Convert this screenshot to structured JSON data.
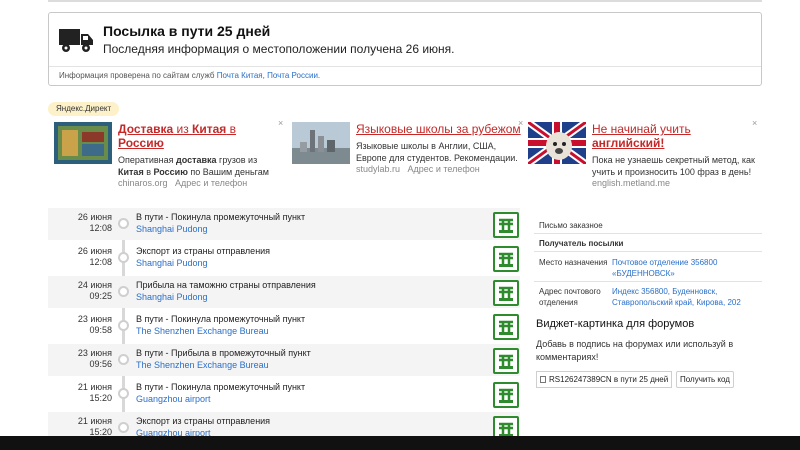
{
  "status": {
    "title": "Посылка в пути 25 дней",
    "subtitle": "Последняя информация о местоположении получена 26 июня.",
    "note_prefix": "Информация проверена по сайтам служб",
    "note_link1": "Почта Китая",
    "note_sep": ",",
    "note_link2": "Почта России",
    "note_end": "."
  },
  "ads": {
    "badge": "Яндекс.Директ",
    "items": [
      {
        "title_part1": "Доставка",
        "title_part2": " из ",
        "title_part3": "Китая",
        "title_part4": " в ",
        "title_part5": "Россию",
        "text_part1": "Оперативная ",
        "text_part2": "доставка",
        "text_part3": " грузов из ",
        "text_part4": "Китая",
        "text_part5": " в ",
        "text_part6": "Россию",
        "text_part7": " по Вашим деньгам",
        "domain": "chinaros.org",
        "contact": "Адрес и телефон"
      },
      {
        "title": "Языковые школы за рубежом",
        "text": "Языковые школы в Англии, США, Европе для студентов. Рекомендации.",
        "domain": "studylab.ru",
        "contact": "Адрес и телефон"
      },
      {
        "title_line1": "Не начинай учить",
        "title_line2": "английский!",
        "text": "Пока не узнаешь секретный метод, как учить и произносить 100 фраз в день!",
        "domain": "english.metland.me"
      }
    ]
  },
  "timeline": [
    {
      "date": "26 июня",
      "time": "12:08",
      "event": "В пути - Покинула промежуточный пункт",
      "place": "Shanghai Pudong"
    },
    {
      "date": "26 июня",
      "time": "12:08",
      "event": "Экспорт из страны отправления",
      "place": "Shanghai Pudong"
    },
    {
      "date": "24 июня",
      "time": "09:25",
      "event": "Прибыла на таможню страны отправления",
      "place": "Shanghai Pudong"
    },
    {
      "date": "23 июня",
      "time": "09:58",
      "event": "В пути - Покинула промежуточный пункт",
      "place": "The Shenzhen Exchange Bureau"
    },
    {
      "date": "23 июня",
      "time": "09:56",
      "event": "В пути - Прибыла в промежуточный пункт",
      "place": "The Shenzhen Exchange Bureau"
    },
    {
      "date": "21 июня",
      "time": "15:20",
      "event": "В пути - Покинула промежуточный пункт",
      "place": "Guangzhou airport"
    },
    {
      "date": "21 июня",
      "time": "15:20",
      "event": "Экспорт из страны отправления",
      "place": "Guangzhou airport"
    }
  ],
  "info": {
    "type": "Письмо заказное",
    "recipient_header": "Получатель посылки",
    "destination_label": "Место назначения",
    "destination_value": "Почтовое отделение 356800 «БУДЕННОВСК»",
    "address_label": "Адрес почтового отделения",
    "address_value": "Индекс 356800, Буденновск, Ставропольский край, Кирова, 202"
  },
  "widget": {
    "title": "Виджет-картинка для форумов",
    "text": "Добавь в подпись на форумах или используй в комментариях!",
    "code": "RS126247389CN в пути 25 дней",
    "button": "Получить код"
  },
  "colors": {
    "link": "#2a6fc9",
    "ad_title": "#c62828",
    "post_green": "#2e8b2e"
  }
}
